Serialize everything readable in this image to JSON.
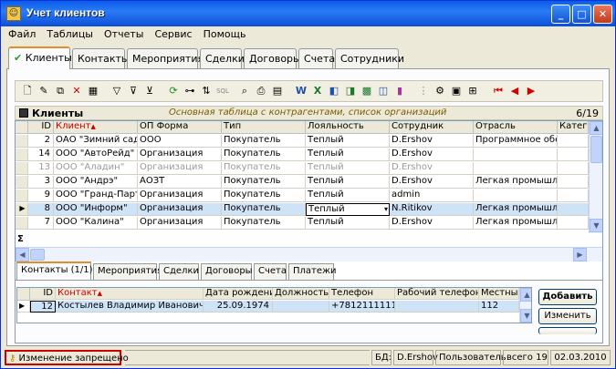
{
  "window": {
    "title": "Учет клиентов"
  },
  "menu": [
    "Файл",
    "Таблицы",
    "Отчеты",
    "Сервис",
    "Помощь"
  ],
  "main_tabs": [
    "Клиенты",
    "Контакты",
    "Мероприятия",
    "Сделки",
    "Договоры",
    "Счета",
    "Сотрудники"
  ],
  "main_tabs_check": "✔",
  "section": {
    "title": "Клиенты",
    "description": "Основная таблица с контрагентами, список организаций",
    "count": "6/19"
  },
  "columns": [
    "ID",
    "Клиент",
    "ОП Форма",
    "Тип",
    "Лояльность",
    "Сотрудник",
    "Отрасль",
    "Катего"
  ],
  "sort_mark": "▲",
  "rows": [
    {
      "id": "2",
      "client": "ОАО \"Зимний сад\"",
      "form": "ООО",
      "type": "Покупатель",
      "loyalty": "Теплый",
      "employee": "D.Ershov",
      "industry": "Программное обес",
      "gray": false
    },
    {
      "id": "14",
      "client": "ООО \"АвтоРейд\"",
      "form": "Организация",
      "type": "Покупатель",
      "loyalty": "Теплый",
      "employee": "D.Ershov",
      "industry": "",
      "gray": false
    },
    {
      "id": "13",
      "client": "ООО \"Аладин\"",
      "form": "Организация",
      "type": "Покупатель",
      "loyalty": "Теплый",
      "employee": "D.Ershov",
      "industry": "",
      "gray": true
    },
    {
      "id": "3",
      "client": "ООО \"Андрэ\"",
      "form": "АОЗТ",
      "type": "Покупатель",
      "loyalty": "Теплый",
      "employee": "D.Ershov",
      "industry": "Легкая промышлен",
      "gray": false
    },
    {
      "id": "9",
      "client": "ООО \"Гранд-Партн",
      "form": "Организация",
      "type": "Покупатель",
      "loyalty": "Теплый",
      "employee": "admin",
      "industry": "",
      "gray": false
    },
    {
      "id": "8",
      "client": "ООО \"Информ\"",
      "form": "Организация",
      "type": "Покупатель",
      "loyalty": "Теплый",
      "employee": "N.Ritikov",
      "industry": "Легкая промышлен",
      "gray": false
    },
    {
      "id": "7",
      "client": "ООО \"Калина\"",
      "form": "Организация",
      "type": "Покупатель",
      "loyalty": "Теплый",
      "employee": "D.Ershov",
      "industry": "Легкая промышлен",
      "gray": false
    }
  ],
  "sum_symbol": "Σ",
  "sub_tabs": [
    "Контакты (1/1)",
    "Мероприятия",
    "Сделки",
    "Договоры",
    "Счета",
    "Платежи"
  ],
  "contact_columns": [
    "ID",
    "Контакт",
    "Дата рождения",
    "Должность",
    "Телефон",
    "Рабочий телефон",
    "Местный"
  ],
  "contact_row": {
    "id": "12",
    "name": "Костылев Владимир Иванович",
    "birth": "25.09.1974",
    "position": "",
    "phone": "+78121111111",
    "work_phone": "",
    "local": "112"
  },
  "buttons": {
    "add": "Добавить",
    "edit": "Изменить"
  },
  "status": {
    "message": "Изменение запрещено",
    "db_label": "БД:",
    "user": "D.Ershov",
    "role": "Пользователь",
    "total": "всего 19",
    "date": "02.03.2010"
  },
  "colors": {
    "accent_red": "#cc0000",
    "selected_row": "#cfe3f7"
  }
}
